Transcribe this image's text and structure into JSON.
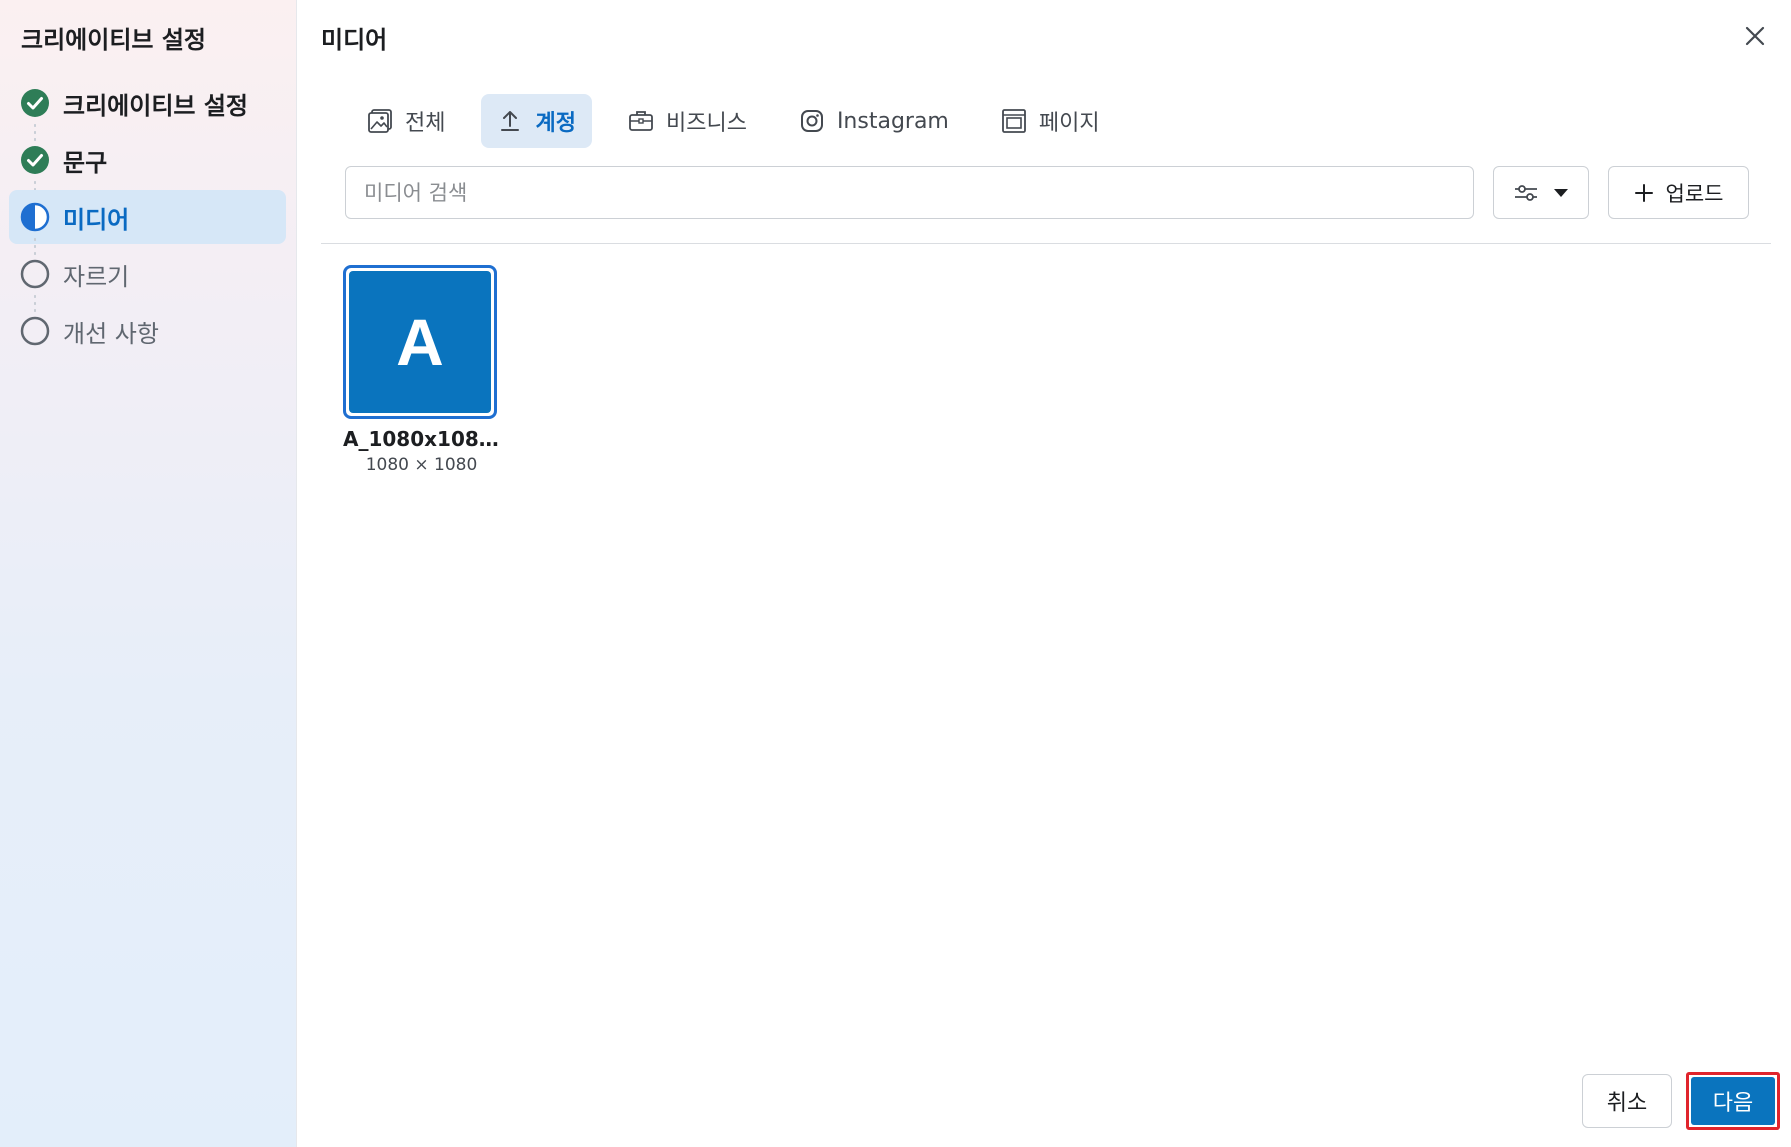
{
  "sidebar": {
    "title": "크리에이티브 설정",
    "steps": [
      {
        "label": "크리에이티브 설정",
        "state": "done"
      },
      {
        "label": "문구",
        "state": "done"
      },
      {
        "label": "미디어",
        "state": "active"
      },
      {
        "label": "자르기",
        "state": "todo"
      },
      {
        "label": "개선 사항",
        "state": "todo"
      }
    ]
  },
  "main": {
    "title": "미디어",
    "tabs": [
      {
        "label": "전체",
        "icon": "image-gallery-icon"
      },
      {
        "label": "계정",
        "icon": "upload-arrow-icon",
        "active": true
      },
      {
        "label": "비즈니스",
        "icon": "briefcase-icon"
      },
      {
        "label": "Instagram",
        "icon": "instagram-icon"
      },
      {
        "label": "페이지",
        "icon": "page-icon"
      }
    ],
    "search": {
      "placeholder": "미디어 검색",
      "value": ""
    },
    "filter": {
      "icon": "sliders-icon",
      "dropdown_icon": "caret-down-icon"
    },
    "upload_label": "업로드",
    "media": [
      {
        "thumb_letter": "A",
        "name": "A_1080x108...",
        "dims": "1080 × 1080",
        "selected": true
      }
    ],
    "cancel_label": "취소",
    "next_label": "다음"
  },
  "colors": {
    "accent": "#0a74be",
    "active_text": "#0a6ac2",
    "done_green": "#2e7d57",
    "highlight_border": "#e0242c"
  }
}
